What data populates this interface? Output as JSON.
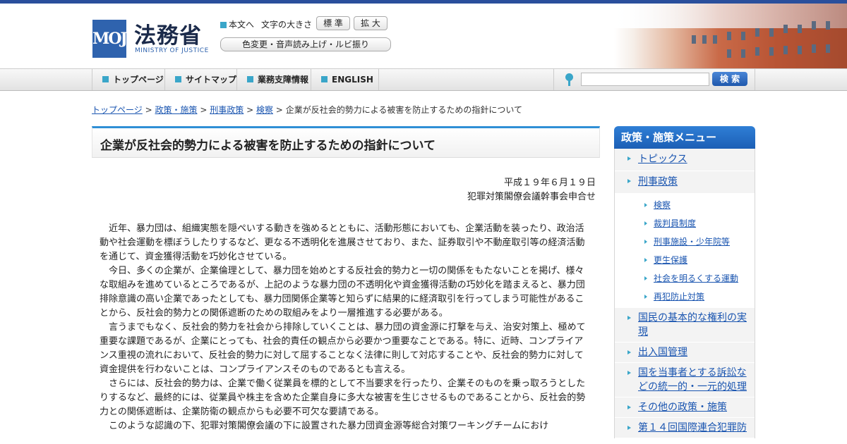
{
  "header": {
    "logo_mark": "MOJ",
    "logo_text": "法務省",
    "logo_sub": "MINISTRY OF JUSTICE",
    "skip_link": "本文へ",
    "font_size_label": "文字の大きさ",
    "font_std": "標 準",
    "font_large": "拡 大",
    "accessibility": "色変更・音声読み上げ・ルビ振り"
  },
  "nav": {
    "items": [
      {
        "label": "トップページ",
        "icon": "home-icon"
      },
      {
        "label": "サイトマップ",
        "icon": "square-icon"
      },
      {
        "label": "業務支障情報",
        "icon": "square-icon"
      },
      {
        "label": "ENGLISH",
        "icon": "square-icon"
      }
    ],
    "search_button": "検 索",
    "search_value": ""
  },
  "breadcrumb": {
    "items": [
      "トップページ",
      "政策・施策",
      "刑事政策",
      "検察"
    ],
    "current": "企業が反社会的勢力による被害を防止するための指針について",
    "separator": ">"
  },
  "main": {
    "title": "企業が反社会的勢力による被害を防止するための指針について",
    "date": "平成１９年６月１９日",
    "issuer": "犯罪対策閣僚会議幹事会申合せ",
    "paragraphs": [
      "近年、暴力団は、組織実態を隠ぺいする動きを強めるとともに、活動形態においても、企業活動を装ったり、政治活動や社会運動を標ぼうしたりするなど、更なる不透明化を進展させており、また、証券取引や不動産取引等の経済活動を通じて、資金獲得活動を巧妙化させている。",
      "今日、多くの企業が、企業倫理として、暴力団を始めとする反社会的勢力と一切の関係をもたないことを掲げ、様々な取組みを進めているところであるが、上記のような暴力団の不透明化や資金獲得活動の巧妙化を踏まえると、暴力団排除意識の高い企業であったとしても、暴力団関係企業等と知らずに結果的に経済取引を行ってしまう可能性があることから、反社会的勢力との関係遮断のための取組みをより一層推進する必要がある。",
      "言うまでもなく、反社会的勢力を社会から排除していくことは、暴力団の資金源に打撃を与え、治安対策上、極めて重要な課題であるが、企業にとっても、社会的責任の観点から必要かつ重要なことである。特に、近時、コンプライアンス重視の流れにおいて、反社会的勢力に対して屈することなく法律に則して対応することや、反社会的勢力に対して資金提供を行わないことは、コンプライアンスそのものであるとも言える。",
      "さらには、反社会的勢力は、企業で働く従業員を標的として不当要求を行ったり、企業そのものを乗っ取ろうとしたりするなど、最終的には、従業員や株主を含めた企業自身に多大な被害を生じさせるものであることから、反社会的勢力との関係遮断は、企業防衛の観点からも必要不可欠な要請である。",
      "このような認識の下、犯罪対策閣僚会議の下に設置された暴力団資金源等総合対策ワーキングチームにおけ"
    ]
  },
  "sidebar": {
    "heading": "政策・施策メニュー",
    "items": [
      {
        "label": "トピックス"
      },
      {
        "label": "刑事政策"
      },
      {
        "label": "国民の基本的な権利の実現"
      },
      {
        "label": "出入国管理"
      },
      {
        "label": "国を当事者とする訴訟などの統一的・一元的処理"
      },
      {
        "label": "その他の政策・施策"
      },
      {
        "label": "第１４回国際連合犯罪防"
      }
    ],
    "subitems": [
      "検察",
      "裁判員制度",
      "刑事施設・少年院等",
      "更生保護",
      "社会を明るくする運動",
      "再犯防止対策"
    ]
  },
  "colors": {
    "brand": "#2f63ae",
    "accent": "#3aa6c9",
    "link": "#1a55b0",
    "title_rule": "#2f8fd6"
  }
}
